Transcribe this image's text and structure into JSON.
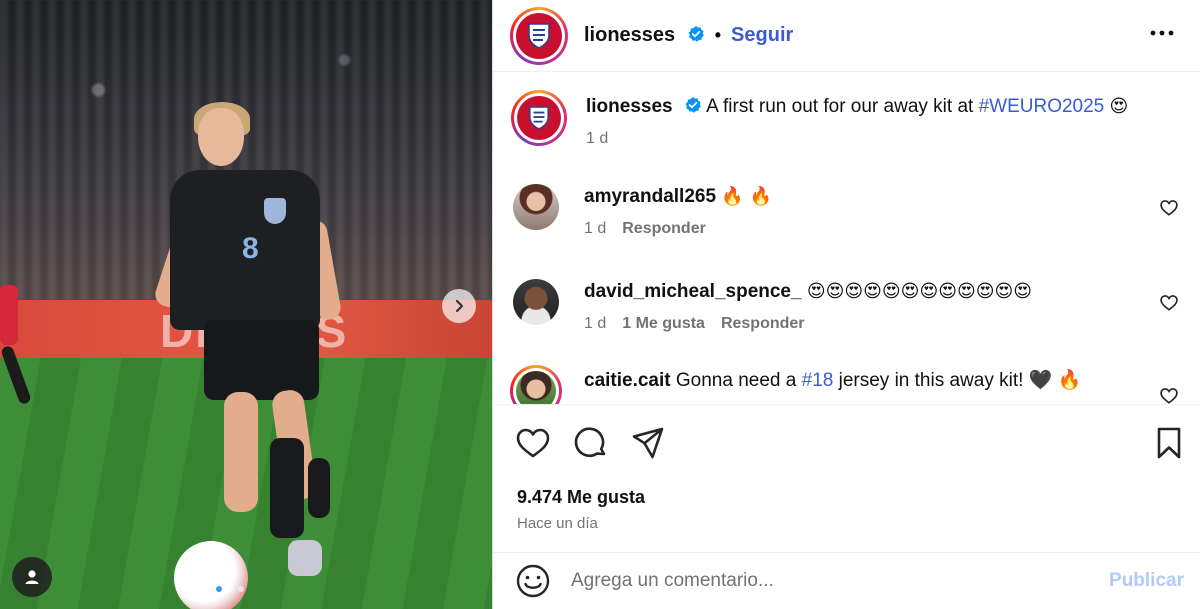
{
  "post": {
    "author": "lionesses",
    "follow_label": "Seguir",
    "caption_text": "A first run out for our away kit at",
    "caption_tag": "#WEURO2025",
    "caption_emoji": "😍",
    "caption_time": "1 d",
    "photo_ad_text": "DE MES",
    "jersey_number": "8"
  },
  "comments": [
    {
      "user": "amyrandall265",
      "text": "🔥 🔥",
      "time": "1 d",
      "likes": "",
      "reply_label": "Responder"
    },
    {
      "user": "david_micheal_spence_",
      "text": "😍😍😍😍😍😍😍😍😍😍😍😍",
      "time": "1 d",
      "likes": "1 Me gusta",
      "reply_label": "Responder"
    },
    {
      "user": "caitie.cait",
      "text_before": "Gonna need a",
      "tag": "#18",
      "text_after": "jersey in this away kit! 🖤 🔥"
    }
  ],
  "stats": {
    "likes": "9.474 Me gusta",
    "posted_ago": "Hace un día"
  },
  "composer": {
    "placeholder": "Agrega un comentario...",
    "publish_label": "Publicar"
  },
  "carousel": {
    "dot_count": 4,
    "active_index": 1
  },
  "icons": [
    "heart-icon",
    "comment-icon",
    "share-icon",
    "bookmark-icon",
    "emoji-icon",
    "more-icon",
    "user-tag-icon",
    "chevron-right-icon",
    "verified-icon"
  ],
  "colors": {
    "link": "#3b5bd6",
    "publish_disabled": "#b2cbf6",
    "verified": "#0095f6",
    "muted": "#737373"
  }
}
